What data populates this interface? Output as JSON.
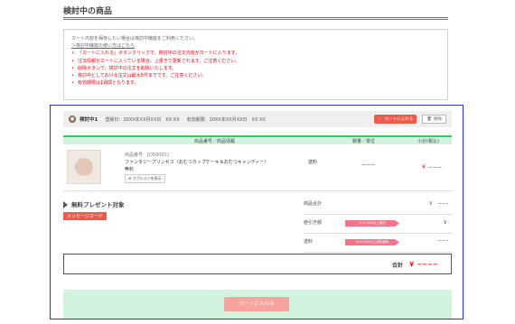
{
  "page": {
    "title": "検討中の商品"
  },
  "notice": {
    "lead": "カート内容を保存したい場合は検討中機能をご利用ください。",
    "link": "＞検討中機能の使い方はこちら",
    "items": [
      "「カートに入れる」ボタンクリックで、検討中の注文内容がカートに入ります。",
      "注文情報がカートに入っている場合、上書きで更新されます。ご注意ください。",
      "削除ボタンで、検討中の注文を削除いたします。",
      "検討中としておける注文は最大5件までです。ご注意ください。",
      "有効期限は1週間となります。"
    ]
  },
  "cart": {
    "icon": "cart-icon",
    "name": "検討中1",
    "registered": "登録日：20XX年XX月XX日　XX:XX",
    "expiry": "有効期限：20XX年XX月XX日　XX:XX",
    "add_small_label": "カートに入れる",
    "delete_label": "削除",
    "columns": {
      "product": "商品番号／商品情報",
      "qty": "数量／単位",
      "subtotal": "小計(税込)"
    },
    "item": {
      "code": "商品番号　[D50001]",
      "name": "ファンタジープリンセス（おむつカップケーキ＆おむつキャンディー）",
      "free": "無料",
      "option_label": "オプションを表示",
      "shipping": "送料",
      "qty": "−−−",
      "subtotal": "￥ −−−"
    },
    "present_label": "無料プレゼント対象",
    "message_card": "メッセージカード",
    "summary": {
      "products": {
        "label": "商品合計",
        "value": "￥　−−−"
      },
      "discount": {
        "label": "値引き額",
        "badge": "￥10,000以上値引",
        "value": "￥-"
      },
      "shipping": {
        "label": "送料",
        "badge": "￥10,000以上送料無料",
        "value": "−−−"
      }
    },
    "total": {
      "label": "合計",
      "value": "￥ −−−−"
    },
    "add_button": "カートに入れる"
  },
  "colors": {
    "accent_red": "#e60012",
    "button_red": "#f05a4a",
    "header_green": "#d2f3dd",
    "green_rule": "#3ac567",
    "selection_border": "#2c2ce0"
  }
}
